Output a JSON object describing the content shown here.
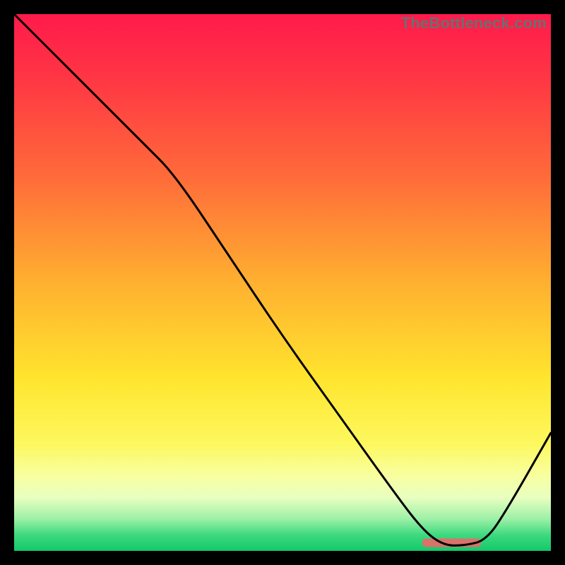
{
  "watermark": "TheBottleneck.com",
  "chart_data": {
    "type": "line",
    "title": "",
    "xlabel": "",
    "ylabel": "",
    "xlim": [
      0,
      100
    ],
    "ylim": [
      0,
      100
    ],
    "grid": false,
    "legend": false,
    "gradient_stops": [
      {
        "offset": 0,
        "color": "#ff1a4b"
      },
      {
        "offset": 0.12,
        "color": "#ff3644"
      },
      {
        "offset": 0.3,
        "color": "#ff6a3a"
      },
      {
        "offset": 0.5,
        "color": "#ffb030"
      },
      {
        "offset": 0.68,
        "color": "#ffe52e"
      },
      {
        "offset": 0.8,
        "color": "#fdf85e"
      },
      {
        "offset": 0.86,
        "color": "#f8ffa0"
      },
      {
        "offset": 0.9,
        "color": "#e9ffc0"
      },
      {
        "offset": 0.94,
        "color": "#9ef0a8"
      },
      {
        "offset": 0.97,
        "color": "#3fd97f"
      },
      {
        "offset": 1.0,
        "color": "#12c96a"
      }
    ],
    "series": [
      {
        "name": "curve",
        "color": "#000000",
        "x": [
          0,
          10,
          24,
          30,
          40,
          50,
          60,
          70,
          76,
          80,
          84,
          88,
          92,
          100
        ],
        "y": [
          100,
          90,
          76,
          70,
          55,
          40,
          26,
          12,
          4,
          1,
          1,
          2,
          8,
          22
        ]
      }
    ],
    "marker": {
      "name": "range-marker",
      "color": "#d9726b",
      "x_start": 76,
      "x_end": 87,
      "y": 1.5,
      "thickness_pct": 1.6
    }
  }
}
